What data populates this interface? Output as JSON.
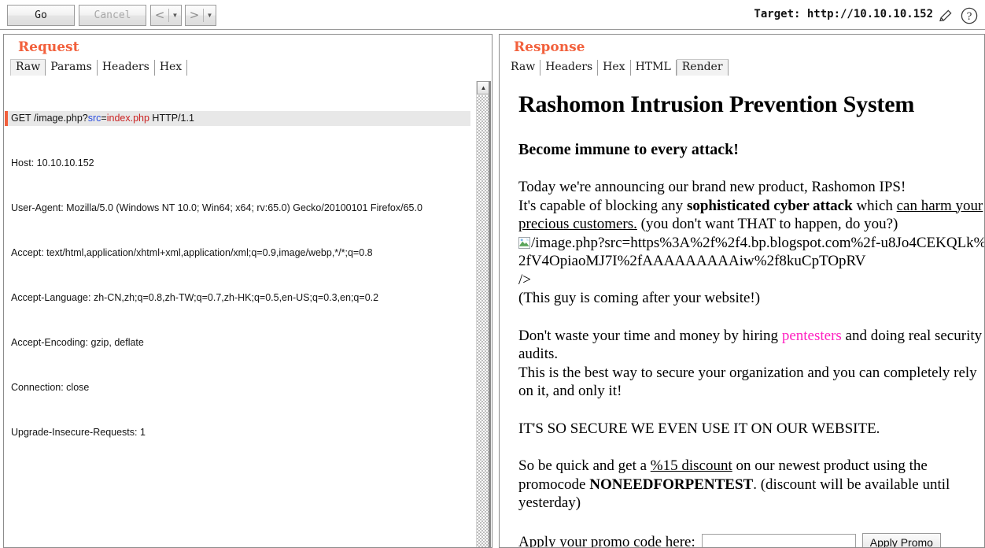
{
  "toolbar": {
    "go_label": "Go",
    "cancel_label": "Cancel",
    "back_glyph": "<",
    "forward_glyph": ">",
    "dropdown_glyph": "▼",
    "target_label": "Target: http://10.10.10.152",
    "edit_icon": "pencil-icon",
    "help_icon": "question-mark-icon"
  },
  "request": {
    "title": "Request",
    "tabs": [
      {
        "label": "Raw",
        "active": true
      },
      {
        "label": "Params",
        "active": false
      },
      {
        "label": "Headers",
        "active": false
      },
      {
        "label": "Hex",
        "active": false
      }
    ],
    "raw_lines": [
      {
        "prefix": "GET /image.php?",
        "param": "src",
        "eq": "=",
        "value": "index.php",
        "suffix": " HTTP/1.1"
      },
      {
        "text": "Host: 10.10.10.152"
      },
      {
        "text": "User-Agent: Mozilla/5.0 (Windows NT 10.0; Win64; x64; rv:65.0) Gecko/20100101 Firefox/65.0"
      },
      {
        "text": "Accept: text/html,application/xhtml+xml,application/xml;q=0.9,image/webp,*/*;q=0.8"
      },
      {
        "text": "Accept-Language: zh-CN,zh;q=0.8,zh-TW;q=0.7,zh-HK;q=0.5,en-US;q=0.3,en;q=0.2"
      },
      {
        "text": "Accept-Encoding: gzip, deflate"
      },
      {
        "text": "Connection: close"
      },
      {
        "text": "Upgrade-Insecure-Requests: 1"
      }
    ],
    "scroll_up_glyph": "▲"
  },
  "response": {
    "title": "Response",
    "tabs": [
      {
        "label": "Raw",
        "active": false
      },
      {
        "label": "Headers",
        "active": false
      },
      {
        "label": "Hex",
        "active": false
      },
      {
        "label": "HTML",
        "active": false
      },
      {
        "label": "Render",
        "active": true
      }
    ],
    "render": {
      "heading": "Rashomon Intrusion Prevention System",
      "subheading": "Become immune to every attack!",
      "para1_line1": "Today we're announcing our brand new product, Rashomon IPS!",
      "para1_line2_pre": "It's capable of blocking any ",
      "para1_bold": "sophisticated cyber attack",
      "para1_line2_mid": " which ",
      "para1_underline": "can harm your precious customers.",
      "para1_line2_post": " (you don't want THAT to happen, do you?)",
      "broken_image_icon": "broken-image-icon",
      "image_alt_text": "/image.php?src=https%3A%2f%2f4.bp.blogspot.com%2f-u8Jo4CEKQLk%2fV4OpiaoMJ7I%2fAAAAAAAAAiw%2f8kuCpTOpRV",
      "image_alt_tail": "/>",
      "para2": "(This guy is coming after your website!)",
      "para3_pre": "Don't waste your time and money by hiring ",
      "para3_link": "pentesters",
      "para3_post": " and doing real security audits.",
      "para3_line2": "This is the best way to secure your organization and you can completely rely on it, and only it!",
      "para4": "IT'S SO SECURE WE EVEN USE IT ON OUR WEBSITE.",
      "para5_pre": "So be quick and get a ",
      "para5_underline": "%15 discount",
      "para5_mid": " on our newest product using the promocode ",
      "para5_bold": "NONEEDFORPENTEST",
      "para5_post": ". (discount will be available until yesterday)",
      "promo_label": "Apply your promo code here:",
      "promo_input_value": "",
      "promo_input_placeholder": "",
      "apply_promo_label": "Apply Promo"
    }
  },
  "colors": {
    "accent_orange": "#f2603c",
    "link_pink": "#ff20c0",
    "param_blue": "#2b4ee0",
    "value_red": "#cc2222"
  }
}
